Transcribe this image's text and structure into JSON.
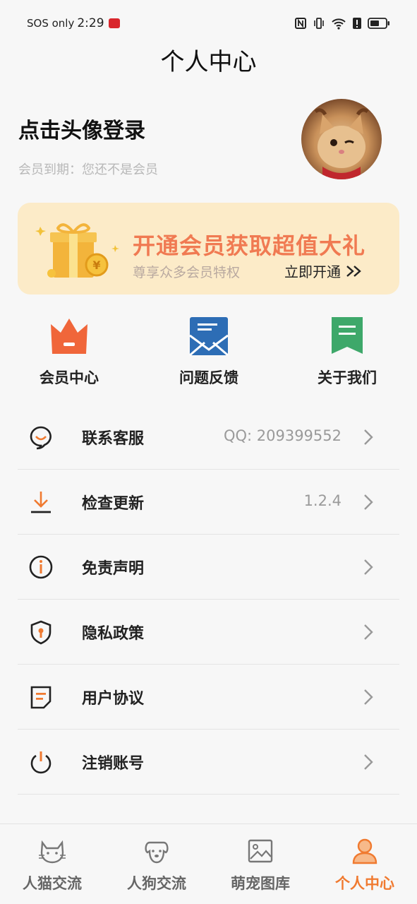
{
  "status_bar": {
    "carrier": "SOS only",
    "time": "2:29"
  },
  "header": {
    "title": "个人中心"
  },
  "profile": {
    "login_prompt": "点击头像登录",
    "member_expiry": "会员到期：您还不是会员"
  },
  "vip_banner": {
    "title": "开通会员获取超值大礼",
    "subtitle": "尊享众多会员特权",
    "action": "立即开通"
  },
  "quick_actions": [
    {
      "label": "会员中心",
      "icon": "crown-icon"
    },
    {
      "label": "问题反馈",
      "icon": "envelope-icon"
    },
    {
      "label": "关于我们",
      "icon": "bookmark-icon"
    }
  ],
  "menu": [
    {
      "label": "联系客服",
      "value": "QQ: 209399552",
      "icon": "chat-icon"
    },
    {
      "label": "检查更新",
      "value": "1.2.4",
      "icon": "download-icon"
    },
    {
      "label": "免责声明",
      "value": "",
      "icon": "info-icon"
    },
    {
      "label": "隐私政策",
      "value": "",
      "icon": "shield-icon"
    },
    {
      "label": "用户协议",
      "value": "",
      "icon": "document-icon"
    },
    {
      "label": "注销账号",
      "value": "",
      "icon": "power-icon"
    }
  ],
  "tabbar": {
    "tabs": [
      {
        "label": "人猫交流",
        "icon": "cat-icon"
      },
      {
        "label": "人狗交流",
        "icon": "dog-icon"
      },
      {
        "label": "萌宠图库",
        "icon": "image-icon"
      },
      {
        "label": "个人中心",
        "icon": "person-icon"
      }
    ],
    "active_index": 3
  },
  "colors": {
    "accent": "#f07a30",
    "banner_bg": "#fcebc8",
    "banner_title": "#f07a52",
    "crown": "#f0663a",
    "envelope": "#2d6db5",
    "bookmark": "#3ea86a"
  }
}
